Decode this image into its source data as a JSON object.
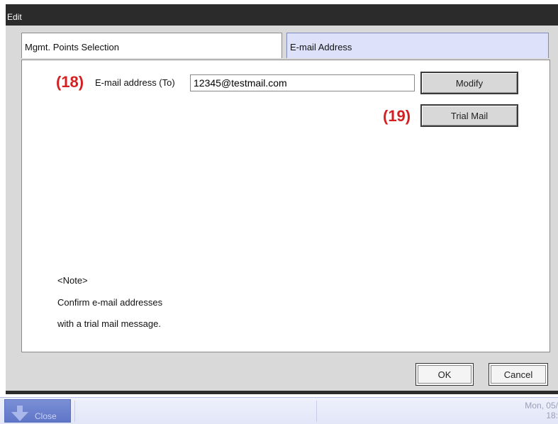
{
  "window": {
    "title": "Edit"
  },
  "tabs": [
    {
      "label": "Mgmt. Points Selection",
      "selected": false
    },
    {
      "label": "E-mail Address",
      "selected": true
    }
  ],
  "email": {
    "marker": "(18)",
    "label": "E-mail address (To)",
    "value": "12345@testmail.com",
    "modify_label": "Modify"
  },
  "trial": {
    "marker": "(19)",
    "label": "Trial Mail"
  },
  "note": {
    "heading": "<Note>",
    "line1": "Confirm e-mail addresses",
    "line2": "with a trial mail message."
  },
  "footer": {
    "ok_label": "OK",
    "cancel_label": "Cancel"
  },
  "taskbar": {
    "close_label": "Close",
    "date": "Mon, 05/",
    "time": "18:"
  },
  "colors": {
    "marker": "#d42020",
    "selected_tab": "#dde2fa",
    "taskbar_button": "#6a80cf"
  }
}
